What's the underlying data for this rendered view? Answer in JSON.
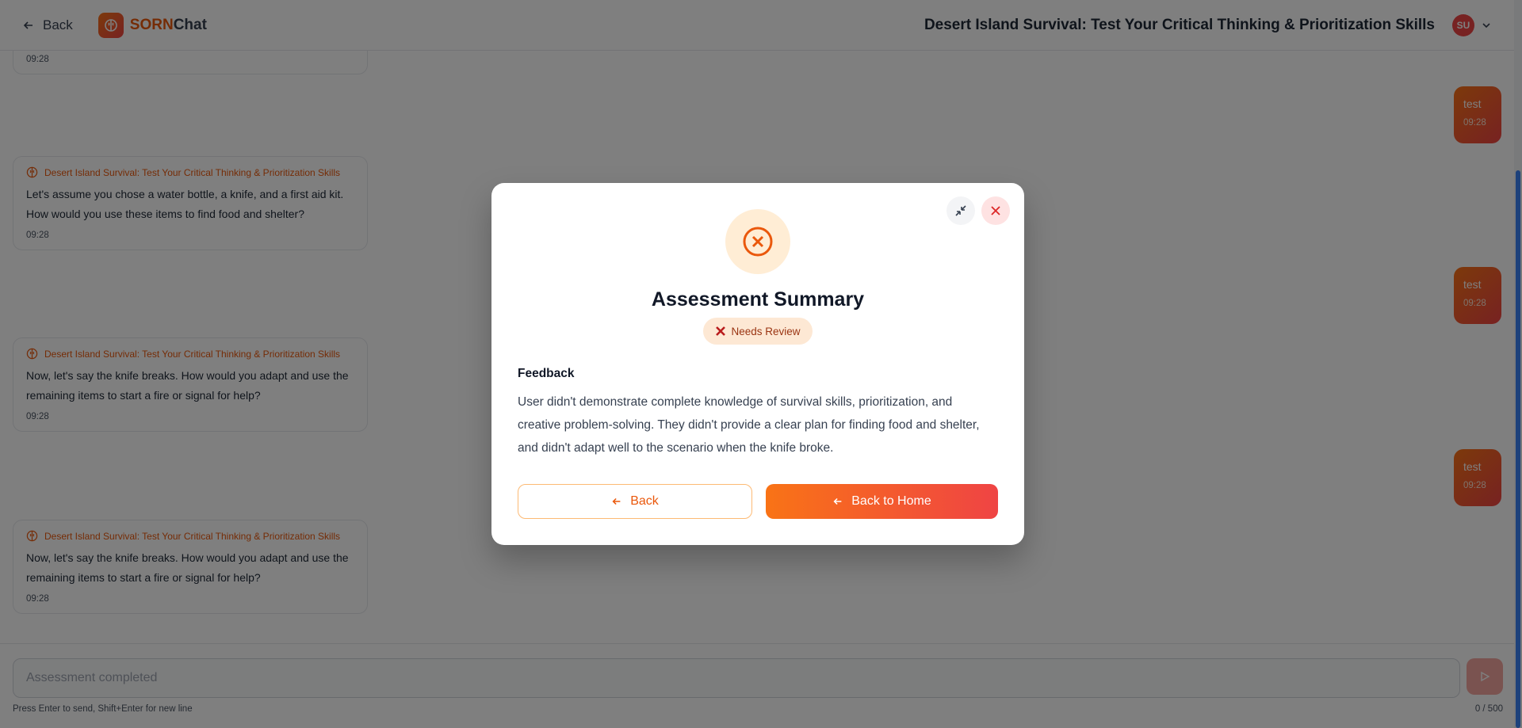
{
  "header": {
    "back_label": "Back",
    "brand_part1": "SORN",
    "brand_part2": "Chat",
    "title": "Desert Island Survival: Test Your Critical Thinking & Prioritization Skills",
    "avatar_initials": "SU"
  },
  "chat": {
    "top_partial_time": "09:28",
    "bot_messages": [
      {
        "sender": "Desert Island Survival: Test Your Critical Thinking & Prioritization Skills",
        "text": "Let's assume you chose a water bottle, a knife, and a first aid kit. How would you use these items to find food and shelter?",
        "time": "09:28"
      },
      {
        "sender": "Desert Island Survival: Test Your Critical Thinking & Prioritization Skills",
        "text": "Now, let's say the knife breaks. How would you adapt and use the remaining items to start a fire or signal for help?",
        "time": "09:28"
      },
      {
        "sender": "Desert Island Survival: Test Your Critical Thinking & Prioritization Skills",
        "text": "Now, let's say the knife breaks. How would you adapt and use the remaining items to start a fire or signal for help?",
        "time": "09:28"
      }
    ],
    "user_messages": [
      {
        "text": "test",
        "time": "09:28"
      },
      {
        "text": "test",
        "time": "09:28"
      },
      {
        "text": "test",
        "time": "09:28"
      }
    ]
  },
  "input": {
    "placeholder": "Assessment completed",
    "hint": "Press Enter to send, Shift+Enter for new line",
    "counter": "0 / 500"
  },
  "modal": {
    "title": "Assessment Summary",
    "badge": "Needs Review",
    "feedback_label": "Feedback",
    "feedback_text": "User didn't demonstrate complete knowledge of survival skills, prioritization, and creative problem-solving. They didn't provide a clear plan for finding food and shelter, and didn't adapt well to the scenario when the knife broke.",
    "back_button": "Back",
    "home_button": "Back to Home"
  },
  "colors": {
    "accent": "#f97316",
    "accent_red": "#ef4444",
    "scrollbar": "#3b82f6"
  }
}
